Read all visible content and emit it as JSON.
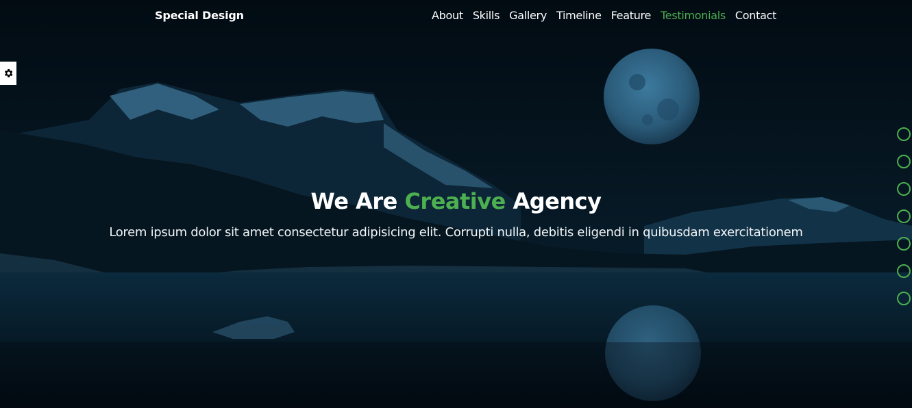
{
  "header": {
    "logo": "Special Design",
    "nav": [
      {
        "label": "About",
        "active": false
      },
      {
        "label": "Skills",
        "active": false
      },
      {
        "label": "Gallery",
        "active": false
      },
      {
        "label": "Timeline",
        "active": false
      },
      {
        "label": "Feature",
        "active": false
      },
      {
        "label": "Testimonials",
        "active": true
      },
      {
        "label": "Contact",
        "active": false
      }
    ]
  },
  "settings": {
    "icon": "gear-icon"
  },
  "hero": {
    "title_before": "We Are ",
    "title_accent": "Creative",
    "title_after": " Agency",
    "subtitle": "Lorem ipsum dolor sit amet consectetur adipisicing elit. Corrupti nulla, debitis eligendi in quibusdam exercitationem"
  },
  "bullets": [
    "",
    "",
    "",
    "",
    "",
    "",
    ""
  ],
  "colors": {
    "accent": "#4caf50",
    "background": "#03101a",
    "text": "#ffffff"
  }
}
